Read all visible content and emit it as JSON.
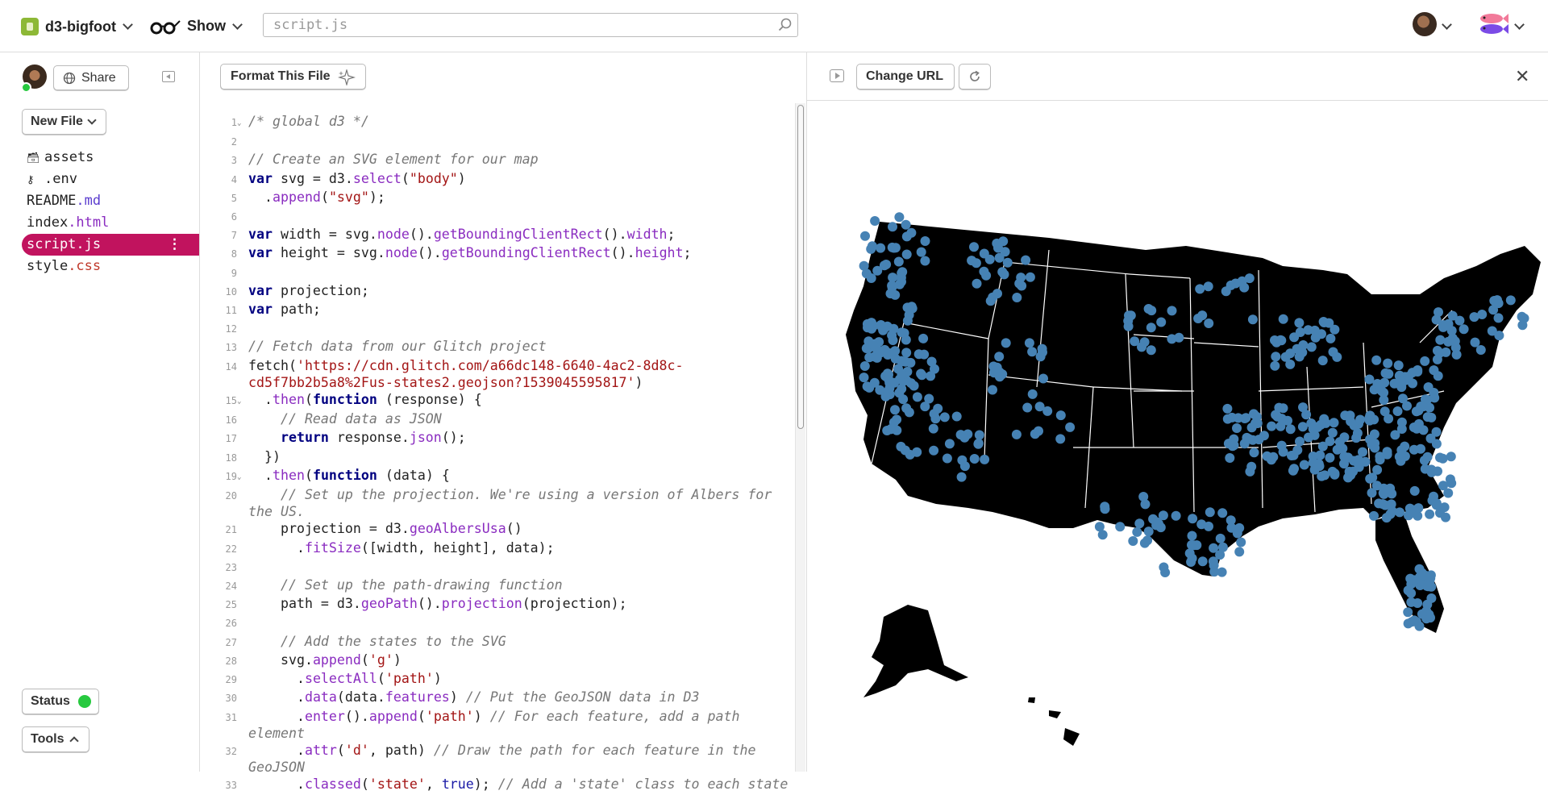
{
  "header": {
    "project_name": "d3-bigfoot",
    "show_label": "Show",
    "search_value": "script.js"
  },
  "sidebar": {
    "share_label": "Share",
    "new_file_label": "New File",
    "files": [
      {
        "base": "assets",
        "ext": "",
        "icon": "archive-icon"
      },
      {
        "base": ".env",
        "ext": "",
        "icon": "key-icon"
      },
      {
        "base": "README",
        "ext": ".md"
      },
      {
        "base": "index",
        "ext": ".html"
      },
      {
        "base": "script",
        "ext": ".js",
        "active": true
      },
      {
        "base": "style",
        "ext": ".css"
      }
    ],
    "status_label": "Status",
    "tools_label": "Tools"
  },
  "editor": {
    "format_label": "Format This File",
    "lines": [
      {
        "n": "1",
        "fold": true,
        "html": "<span class='cm'>/* global d3 */</span>"
      },
      {
        "n": "2",
        "html": ""
      },
      {
        "n": "3",
        "html": "<span class='cm'>// Create an SVG element for our map</span>"
      },
      {
        "n": "4",
        "html": "<span class='kw'>var</span> svg = d3.<span class='fn'>select</span>(<span class='st'>\"body\"</span>)"
      },
      {
        "n": "5",
        "html": "  .<span class='fn'>append</span>(<span class='st'>\"svg\"</span>);"
      },
      {
        "n": "6",
        "html": ""
      },
      {
        "n": "7",
        "html": "<span class='kw'>var</span> width = svg.<span class='fn'>node</span>().<span class='fn'>getBoundingClientRect</span>().<span class='fn'>width</span>;"
      },
      {
        "n": "8",
        "html": "<span class='kw'>var</span> height = svg.<span class='fn'>node</span>().<span class='fn'>getBoundingClientRect</span>().<span class='fn'>height</span>;"
      },
      {
        "n": "9",
        "html": ""
      },
      {
        "n": "10",
        "html": "<span class='kw'>var</span> projection;"
      },
      {
        "n": "11",
        "html": "<span class='kw'>var</span> path;"
      },
      {
        "n": "12",
        "html": ""
      },
      {
        "n": "13",
        "html": "<span class='cm'>// Fetch data from our Glitch project</span>"
      },
      {
        "n": "14",
        "html": "fetch(<span class='st'>'https://cdn.glitch.com/a66dc148-6640-4ac2-8d8c-cd5f7bb2b5a8%2Fus-states2.geojson?1539045595817'</span>)"
      },
      {
        "n": "15",
        "fold": true,
        "html": "  .<span class='fn'>then</span>(<span class='kw'>function</span> (response) {"
      },
      {
        "n": "16",
        "html": "    <span class='cm'>// Read data as JSON</span>"
      },
      {
        "n": "17",
        "html": "    <span class='kw'>return</span> response.<span class='fn'>json</span>();"
      },
      {
        "n": "18",
        "html": "  })"
      },
      {
        "n": "19",
        "fold": true,
        "html": "  .<span class='fn'>then</span>(<span class='kw'>function</span> (data) {"
      },
      {
        "n": "20",
        "html": "    <span class='cm'>// Set up the projection. We're using a version of Albers for the US.</span>"
      },
      {
        "n": "21",
        "html": "    projection = d3.<span class='fn'>geoAlbersUsa</span>()"
      },
      {
        "n": "22",
        "html": "      .<span class='fn'>fitSize</span>([width, height], data);"
      },
      {
        "n": "23",
        "html": ""
      },
      {
        "n": "24",
        "html": "    <span class='cm'>// Set up the path-drawing function</span>"
      },
      {
        "n": "25",
        "html": "    path = d3.<span class='fn'>geoPath</span>().<span class='fn'>projection</span>(projection);"
      },
      {
        "n": "26",
        "html": ""
      },
      {
        "n": "27",
        "html": "    <span class='cm'>// Add the states to the SVG</span>"
      },
      {
        "n": "28",
        "html": "    svg.<span class='fn'>append</span>(<span class='st'>'g'</span>)"
      },
      {
        "n": "29",
        "html": "      .<span class='fn'>selectAll</span>(<span class='st'>'path'</span>)"
      },
      {
        "n": "30",
        "html": "      .<span class='fn'>data</span>(data.<span class='fn'>features</span>) <span class='cm'>// Put the GeoJSON data in D3</span>"
      },
      {
        "n": "31",
        "html": "      .<span class='fn'>enter</span>().<span class='fn'>append</span>(<span class='st'>'path'</span>) <span class='cm'>// For each feature, add a path element</span>"
      },
      {
        "n": "32",
        "html": "      .<span class='fn'>attr</span>(<span class='st'>'d'</span>, path) <span class='cm'>// Draw the path for each feature in the GeoJSON</span>"
      },
      {
        "n": "33",
        "html": "      .<span class='fn'>classed</span>(<span class='st'>'state'</span>, <span class='bo'>true</span>); <span class='cm'>// Add a 'state' class to each state</span>"
      }
    ]
  },
  "preview": {
    "change_url_label": "Change URL",
    "map_fill": "#000000",
    "dot_color": "#4682b4"
  },
  "colors": {
    "accent": "#c1135e",
    "status_ok": "#27c93f"
  }
}
